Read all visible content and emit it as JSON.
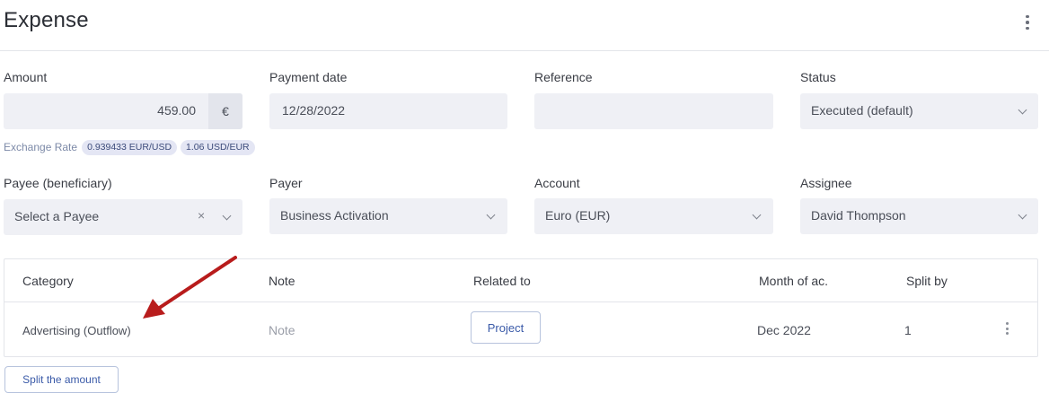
{
  "header": {
    "title": "Expense"
  },
  "fields": {
    "amount": {
      "label": "Amount",
      "value": "459.00",
      "currency": "€"
    },
    "payment_date": {
      "label": "Payment date",
      "value": "12/28/2022"
    },
    "reference": {
      "label": "Reference",
      "value": ""
    },
    "status": {
      "label": "Status",
      "value": "Executed (default)"
    },
    "payee": {
      "label": "Payee (beneficiary)",
      "placeholder": "Select a Payee",
      "clear": "×"
    },
    "payer": {
      "label": "Payer",
      "value": "Business Activation"
    },
    "account": {
      "label": "Account",
      "value": "Euro (EUR)"
    },
    "assignee": {
      "label": "Assignee",
      "value": "David Thompson"
    }
  },
  "exchange_rate": {
    "label": "Exchange Rate",
    "rates": [
      "0.939433 EUR/USD",
      "1.06 USD/EUR"
    ]
  },
  "table": {
    "columns": [
      "Category",
      "Note",
      "Related to",
      "Month of ac.",
      "Split by"
    ],
    "rows": [
      {
        "category": "Advertising (Outflow)",
        "note": "Note",
        "related_button": "Project",
        "month": "Dec 2022",
        "split_by": "1"
      }
    ]
  },
  "split_button": "Split the amount",
  "annotation": {
    "arrow_color": "#b81c1c"
  }
}
